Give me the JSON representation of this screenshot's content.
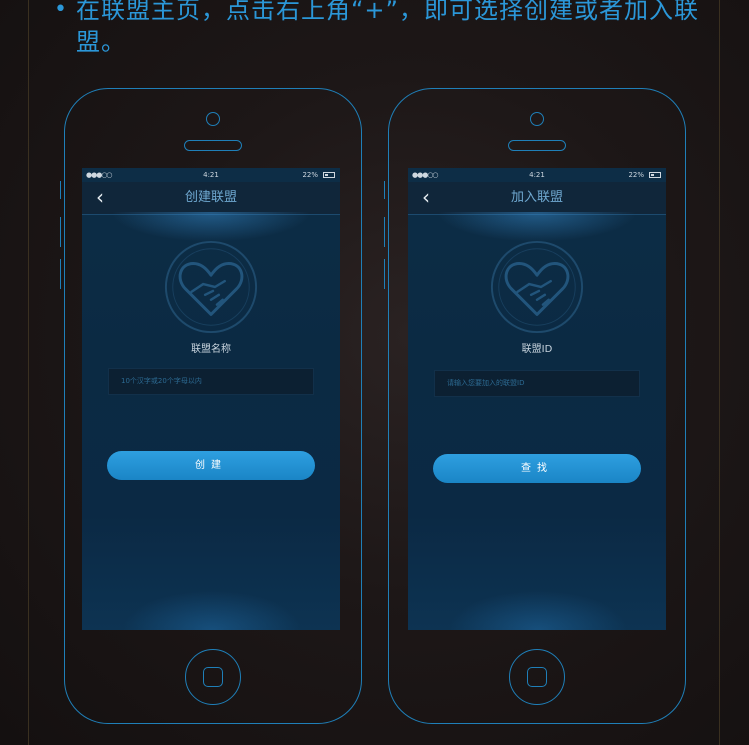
{
  "header": {
    "bullet": "•",
    "text": "在联盟主页，点击右上角“+”，即可选择创建或者加入联盟。"
  },
  "phones": [
    {
      "status": {
        "signal": "●●●○○",
        "time": "4:21",
        "battery": "22%"
      },
      "nav": {
        "back_icon": "chevron-left-icon",
        "title": "创建联盟"
      },
      "logo_icon": "handshake-heart-icon",
      "field_label": "联盟名称",
      "field_placeholder": "10个汉字或20个字母以内",
      "button_label": "创建"
    },
    {
      "status": {
        "signal": "●●●○○",
        "time": "4:21",
        "battery": "22%"
      },
      "nav": {
        "back_icon": "chevron-left-icon",
        "title": "加入联盟"
      },
      "logo_icon": "handshake-heart-icon",
      "field_label": "联盟ID",
      "field_placeholder": "请输入您要加入的联盟ID",
      "button_label": "查找"
    }
  ],
  "colors": {
    "accent": "#2b97d8",
    "outline": "#1f7fb8",
    "button": "#1a85c6",
    "screen_bg": "#0b2a43"
  }
}
